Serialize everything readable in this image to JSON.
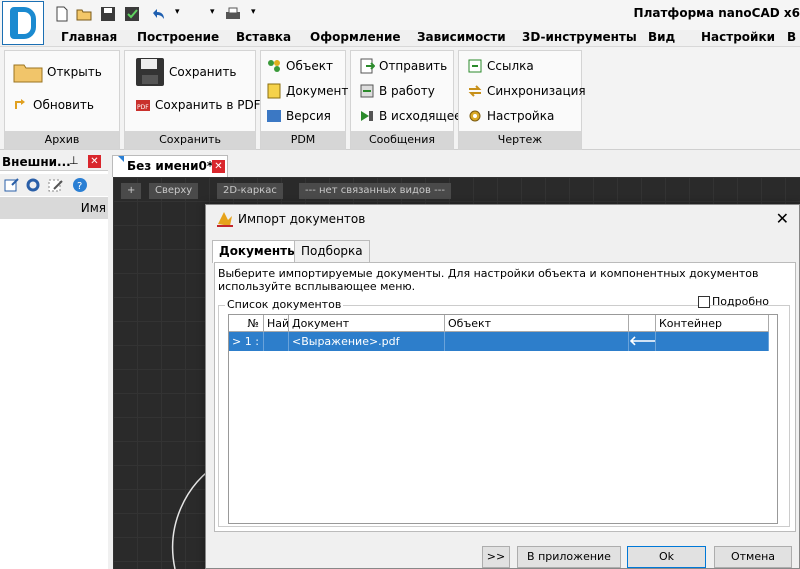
{
  "app_title": "Платформа nanoCAD x6",
  "menu": [
    "Главная",
    "Построение",
    "Вставка",
    "Оформление",
    "Зависимости",
    "3D-инструменты",
    "Вид",
    "Настройки",
    "В"
  ],
  "ribbon": {
    "archive": {
      "title": "Архив",
      "open": "Открыть",
      "refresh": "Обновить"
    },
    "save": {
      "title": "Сохранить",
      "save": "Сохранить",
      "save_pdf": "Сохранить в PDF"
    },
    "pdm": {
      "title": "PDM",
      "object": "Объект",
      "document": "Документ",
      "version": "Версия"
    },
    "messages": {
      "title": "Сообщения",
      "send": "Отправить",
      "to_work": "В работу",
      "outgoing": "В исходящее"
    },
    "drawing": {
      "title": "Чертеж",
      "link": "Ссылка",
      "sync": "Синхронизация",
      "setup": "Настройка"
    }
  },
  "left_panel": {
    "title": "Внешни...",
    "column": "Имя"
  },
  "doc_tab": "Без имени0*",
  "view_bar": {
    "plus": "+",
    "top": "Сверху",
    "wire": "2D-каркас",
    "views": "--- нет связанных видов ---"
  },
  "dialog": {
    "title": "Импорт документов",
    "tabs": [
      "Документы",
      "Подборка"
    ],
    "hint": "Выберите импортируемые документы. Для настройки объекта и компонентных документов используйте всплывающее меню.",
    "group": "Список документов",
    "detail": "Подробно",
    "columns": [
      "№",
      "Най",
      "Документ",
      "Объект",
      "",
      "Контейнер"
    ],
    "rows": [
      {
        "num": "> 1 :",
        "found": "",
        "document": "<Выражение>.pdf",
        "object": "",
        "arrow": "🡐",
        "container": ""
      }
    ],
    "buttons": {
      "more": ">>",
      "to_app": "В приложение",
      "ok": "Ok",
      "cancel": "Отмена"
    }
  },
  "colors": {
    "selection": "#2d7ecb",
    "logo": "#1b8ad0",
    "close_red": "#d9262c"
  }
}
